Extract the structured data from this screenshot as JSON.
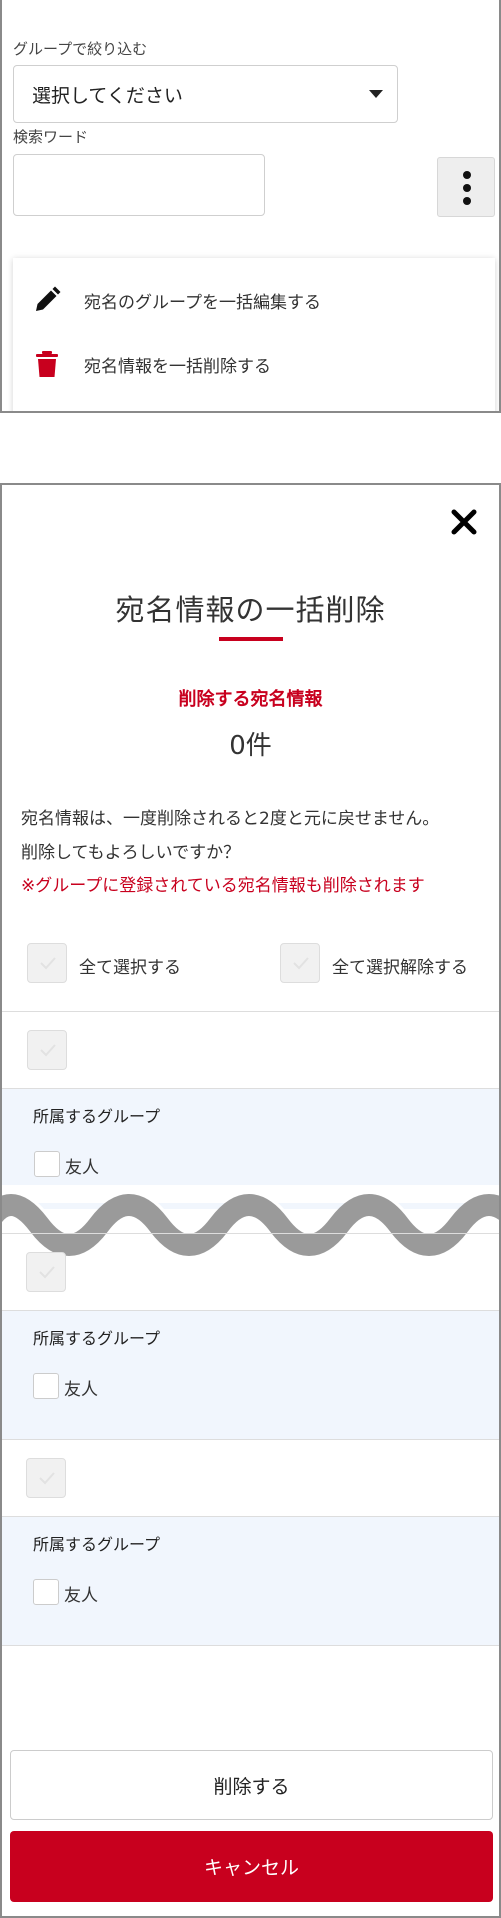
{
  "filters": {
    "group_label": "グループで絞り込む",
    "group_select_value": "選択してください",
    "search_label": "検索ワード",
    "search_value": ""
  },
  "menu": {
    "items": [
      {
        "label": "宛名のグループを一括編集する",
        "icon": "pencil-icon"
      },
      {
        "label": "宛名情報を一括削除する",
        "icon": "trash-icon"
      }
    ]
  },
  "modal": {
    "title": "宛名情報の一括削除",
    "count_label": "削除する宛名情報",
    "count_value": "0件",
    "warning_lines": [
      "宛名情報は、一度削除されると2度と元に戻せません。",
      "削除してもよろしいですか？"
    ],
    "warning_red": "※グループに登録されている宛名情報も削除されます",
    "select_all": "全て選択する",
    "deselect_all": "全て選択解除する",
    "records": [
      {
        "group_heading": "所属するグループ",
        "groups": [
          "友人"
        ]
      },
      {
        "group_heading": "所属するグループ",
        "groups": [
          "友人"
        ]
      },
      {
        "group_heading": "所属するグループ",
        "groups": [
          "友人"
        ]
      }
    ],
    "delete_button": "削除する",
    "cancel_button": "キャンセル"
  },
  "colors": {
    "accent": "#c8001e",
    "group_background": "#f1f6fd",
    "checkbox_background": "#f1f1f1"
  }
}
